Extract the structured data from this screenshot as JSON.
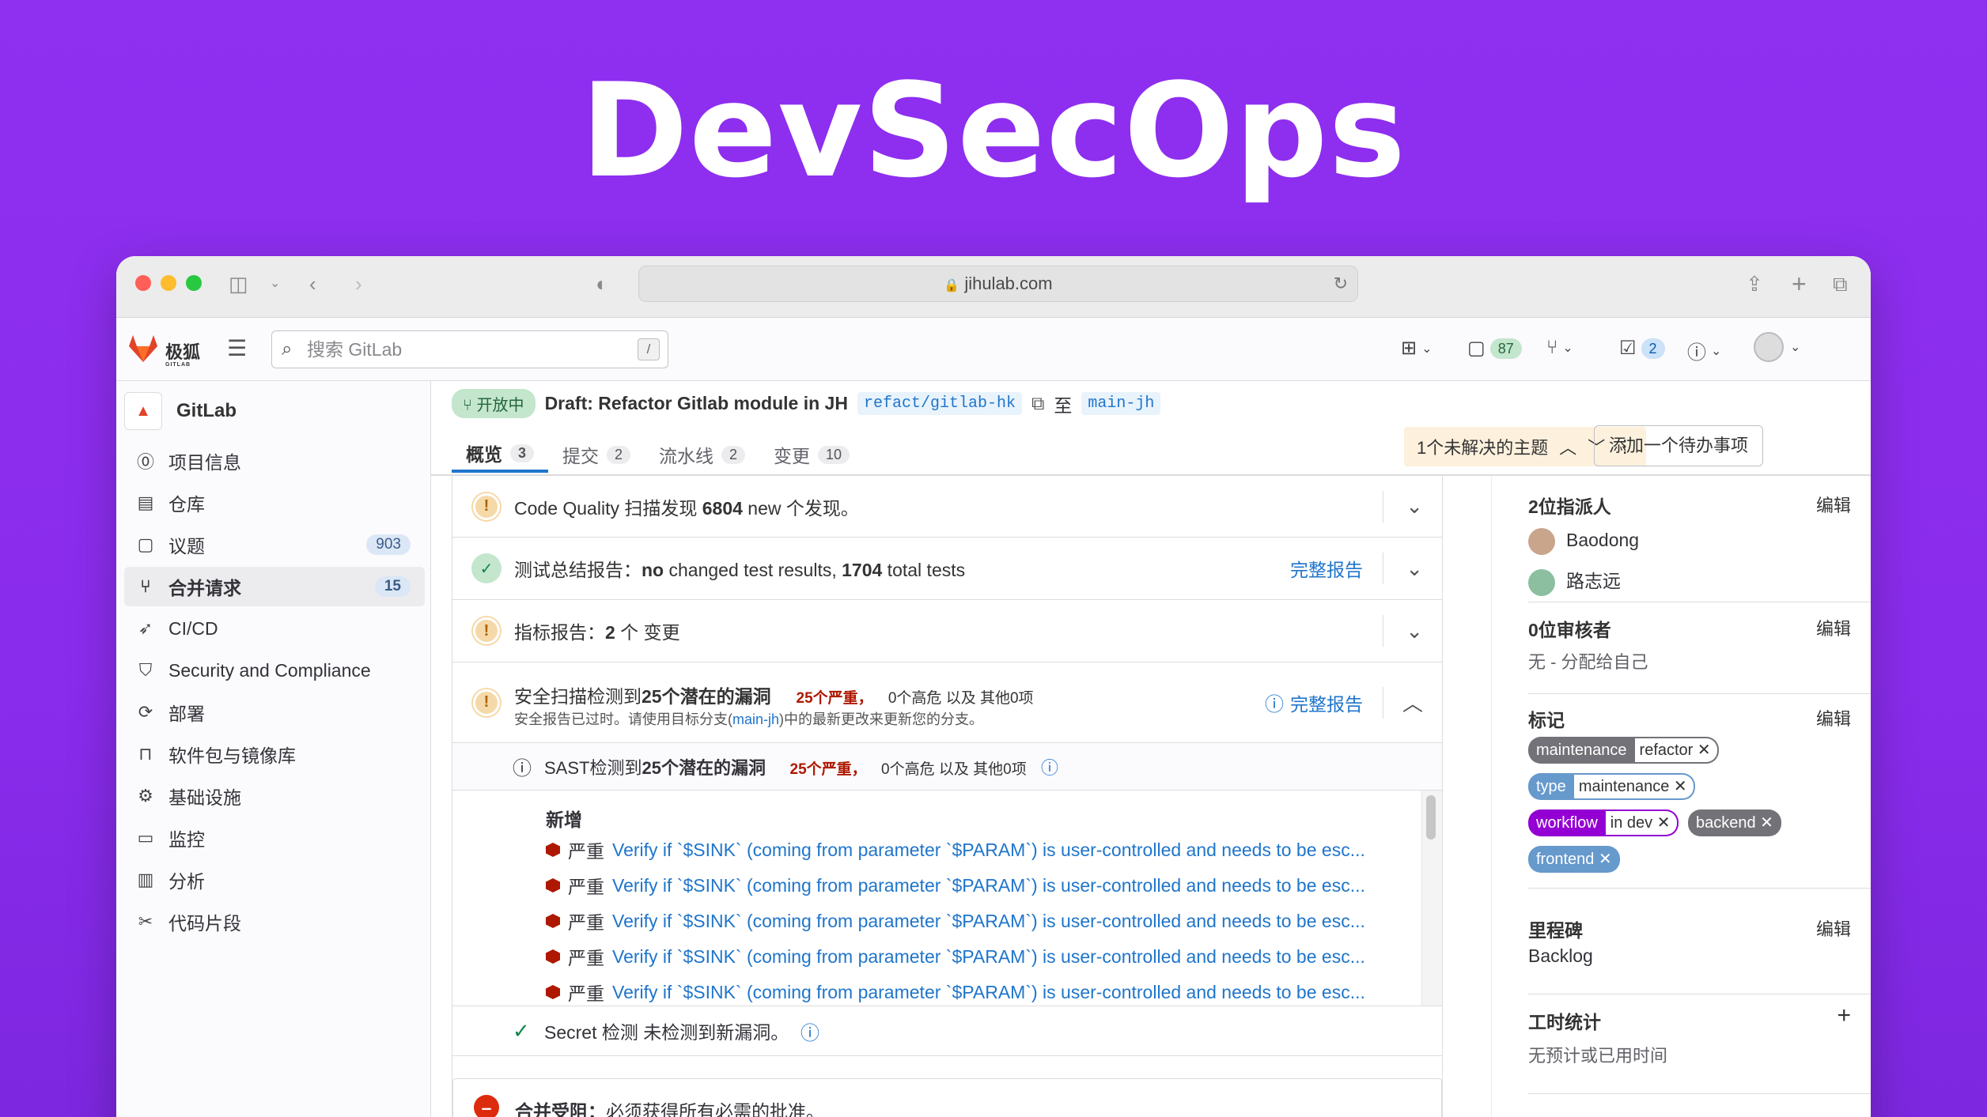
{
  "hero_title": "DevSecOps",
  "browser": {
    "url": "jihulab.com"
  },
  "topnav": {
    "brand": "极狐",
    "brand_sub": "GITLAB",
    "search_placeholder": "搜索 GitLab",
    "search_key": "/",
    "issues_count": "87",
    "todo_count": "2"
  },
  "sidebar": {
    "project": "GitLab",
    "items": [
      {
        "label": "项目信息",
        "icon": "info-icon"
      },
      {
        "label": "仓库",
        "icon": "doc-icon"
      },
      {
        "label": "议题",
        "icon": "issues-icon",
        "count": "903"
      },
      {
        "label": "合并请求",
        "icon": "merge-request-icon",
        "count": "15",
        "active": true
      },
      {
        "label": "CI/CD",
        "icon": "rocket-icon"
      },
      {
        "label": "Security and Compliance",
        "icon": "shield-icon"
      },
      {
        "label": "部署",
        "icon": "deploy-icon"
      },
      {
        "label": "软件包与镜像库",
        "icon": "package-icon"
      },
      {
        "label": "基础设施",
        "icon": "cloud-gear-icon"
      },
      {
        "label": "监控",
        "icon": "monitor-icon"
      },
      {
        "label": "分析",
        "icon": "chart-icon"
      },
      {
        "label": "代码片段",
        "icon": "snippet-icon"
      }
    ]
  },
  "mr": {
    "status": "开放中",
    "title": "Draft: Refactor Gitlab module in JH",
    "source_branch": "refact/gitlab-hk",
    "to": "至",
    "target_branch": "main-jh",
    "tabs": [
      {
        "label": "概览",
        "count": "3"
      },
      {
        "label": "提交",
        "count": "2"
      },
      {
        "label": "流水线",
        "count": "2"
      },
      {
        "label": "变更",
        "count": "10"
      }
    ],
    "threads": "1个未解决的主题",
    "add_todo": "添加一个待办事项"
  },
  "widgets": {
    "code_quality": {
      "prefix": "Code Quality 扫描发现 ",
      "count": "6804",
      "suffix": " new 个发现。"
    },
    "tests": {
      "prefix": "测试总结报告：",
      "bold1": "no",
      "mid": " changed test results, ",
      "bold2": "1704",
      "suffix": " total tests",
      "link": "完整报告"
    },
    "metrics": {
      "prefix": "指标报告：",
      "bold": "2",
      "suffix": " 个 变更"
    },
    "security": {
      "title_a": "安全扫描检测到",
      "title_b": "25个潜在的漏洞",
      "critical": "25个严重，",
      "rest": "0个高危  以及  其他0项",
      "note_a": "安全报告已过时。请使用目标分支(",
      "note_branch": "main-jh",
      "note_b": ")中的最新更改来更新您的分支。",
      "link": "完整报告"
    },
    "sast": {
      "title_a": "SAST检测到",
      "title_b": "25个潜在的漏洞",
      "critical": "25个严重，",
      "rest": "0个高危  以及  其他0项"
    },
    "findings_header": "新增",
    "findings": [
      {
        "sev": "严重",
        "text": "Verify if `$SINK` (coming from parameter `$PARAM`) is user-controlled and needs to be esc..."
      },
      {
        "sev": "严重",
        "text": "Verify if `$SINK` (coming from parameter `$PARAM`) is user-controlled and needs to be esc..."
      },
      {
        "sev": "严重",
        "text": "Verify if `$SINK` (coming from parameter `$PARAM`) is user-controlled and needs to be esc..."
      },
      {
        "sev": "严重",
        "text": "Verify if `$SINK` (coming from parameter `$PARAM`) is user-controlled and needs to be esc..."
      },
      {
        "sev": "严重",
        "text": "Verify if `$SINK` (coming from parameter `$PARAM`) is user-controlled and needs to be esc..."
      }
    ],
    "secret": "Secret 检测 未检测到新漏洞。",
    "merge_blocked_bold": "合并受阻：",
    "merge_blocked": "必须获得所有必需的批准。"
  },
  "right": {
    "assignees": {
      "title": "2位指派人",
      "edit": "编辑",
      "people": [
        "Baodong",
        "路志远"
      ]
    },
    "reviewers": {
      "title": "0位审核者",
      "edit": "编辑",
      "text": "无 - 分配给自己"
    },
    "labels": {
      "title": "标记",
      "edit": "编辑",
      "items": [
        {
          "k": "maintenance",
          "v": "refactor",
          "color": "#737278"
        },
        {
          "k": "type",
          "v": "maintenance",
          "color": "#6699cc"
        },
        {
          "k": "workflow",
          "v": "in dev",
          "color": "#9400d3"
        },
        {
          "k": "backend",
          "v": "",
          "color": "#737278"
        },
        {
          "k": "frontend",
          "v": "",
          "color": "#6699cc"
        }
      ]
    },
    "milestone": {
      "title": "里程碑",
      "edit": "编辑",
      "value": "Backlog"
    },
    "time": {
      "title": "工时统计",
      "value": "无预计或已用时间"
    }
  }
}
